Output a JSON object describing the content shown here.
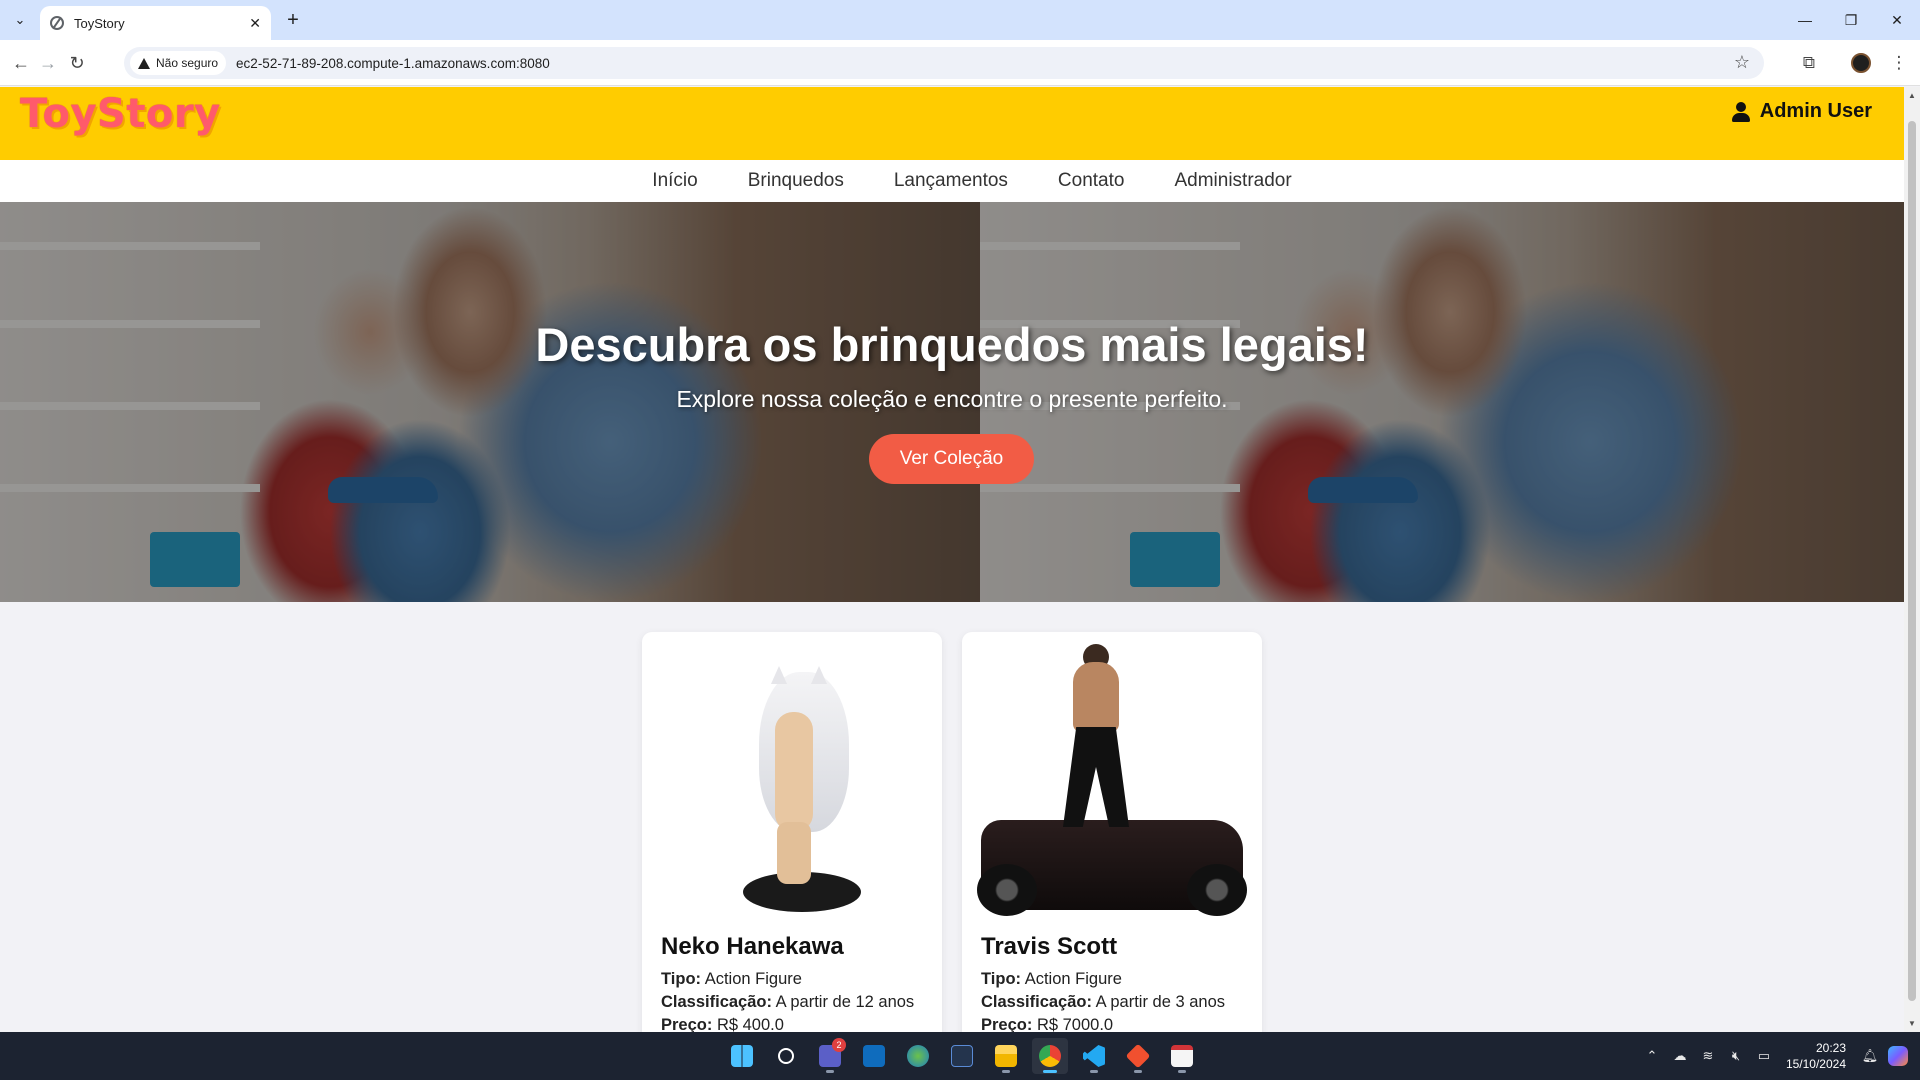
{
  "browser": {
    "tab_title": "ToyStory",
    "tab_close": "✕",
    "new_tab": "+",
    "security_label": "Não seguro",
    "url": "ec2-52-71-89-208.compute-1.amazonaws.com:8080",
    "window_minimize": "—",
    "window_restore": "❐",
    "window_close": "✕"
  },
  "site": {
    "logo": "ToyStory",
    "user_name": "Admin User",
    "nav": [
      "Início",
      "Brinquedos",
      "Lançamentos",
      "Contato",
      "Administrador"
    ]
  },
  "hero": {
    "title": "Descubra os brinquedos mais legais!",
    "subtitle": "Explore nossa coleção e encontre o presente perfeito.",
    "button": "Ver Coleção"
  },
  "products": [
    {
      "name": "Neko Hanekawa",
      "type_label": "Tipo:",
      "type": "Action Figure",
      "rating_label": "Classificação:",
      "rating": "A partir de 12 anos",
      "price_label": "Preço:",
      "price": "R$ 400.0"
    },
    {
      "name": "Travis Scott",
      "type_label": "Tipo:",
      "type": "Action Figure",
      "rating_label": "Classificação:",
      "rating": "A partir de 3 anos",
      "price_label": "Preço:",
      "price": "R$ 7000.0"
    }
  ],
  "taskbar": {
    "teams_badge": "2",
    "time": "20:23",
    "date": "15/10/2024"
  },
  "colors": {
    "header_bg": "#ffcc00",
    "logo": "#ff5a6b",
    "hero_button": "#f25c45",
    "tab_strip": "#d3e3fd",
    "taskbar": "#1c2331"
  }
}
